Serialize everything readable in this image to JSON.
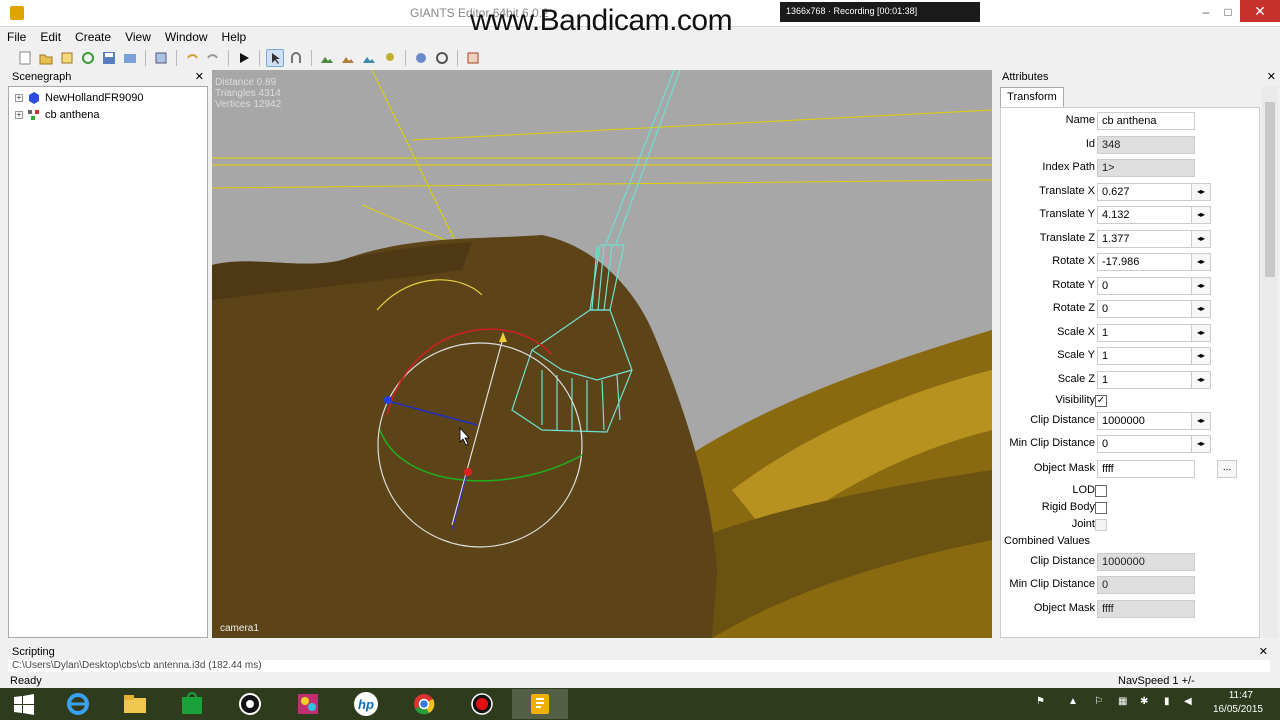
{
  "window": {
    "title": "GIANTS Editor 64bit 6.0.2",
    "watermark": "www.Bandicam.com",
    "recording": "1366x768 · Recording [00:01:38]",
    "minimize": "–",
    "maximize": "□",
    "close": "✕"
  },
  "menu": [
    "File",
    "Edit",
    "Create",
    "View",
    "Window",
    "Help"
  ],
  "toolbar": {
    "icons": [
      "new-icon",
      "open-icon",
      "edit-icon",
      "refresh-icon",
      "save-icon",
      "export-icon",
      "import-icon",
      "undo-icon",
      "redo-icon",
      "play-icon",
      "select-icon",
      "magnet-icon",
      "terrain-icon",
      "paint-icon",
      "foliage-icon",
      "plant-icon",
      "settings-icon",
      "sync-icon",
      "script-icon"
    ]
  },
  "scenegraph": {
    "title": "Scenegraph",
    "close": "✕",
    "items": [
      {
        "label": "NewHollandFR9090",
        "expander": "+"
      },
      {
        "label": "cb anthena",
        "expander": "+"
      }
    ]
  },
  "viewport": {
    "stats": [
      "Distance 0.89",
      "Triangles 4314",
      "Vertices 12942"
    ],
    "camera": "camera1"
  },
  "attributes": {
    "title": "Attributes",
    "close": "✕",
    "tab": "Transform",
    "fields": [
      {
        "label": "Name",
        "value": "cb anthena",
        "kind": "text"
      },
      {
        "label": "Id",
        "value": "348",
        "kind": "readonly"
      },
      {
        "label": "Index Path",
        "value": "1>",
        "kind": "readonly"
      },
      {
        "label": "Translate X",
        "value": "0.627",
        "kind": "spin"
      },
      {
        "label": "Translate Y",
        "value": "4.132",
        "kind": "spin"
      },
      {
        "label": "Translate Z",
        "value": "1.377",
        "kind": "spin"
      },
      {
        "label": "Rotate X",
        "value": "-17.986",
        "kind": "spin"
      },
      {
        "label": "Rotate Y",
        "value": "0",
        "kind": "spin"
      },
      {
        "label": "Rotate Z",
        "value": "0",
        "kind": "spin"
      },
      {
        "label": "Scale X",
        "value": "1",
        "kind": "spin"
      },
      {
        "label": "Scale Y",
        "value": "1",
        "kind": "spin"
      },
      {
        "label": "Scale Z",
        "value": "1",
        "kind": "spin"
      }
    ],
    "visibility": {
      "label": "Visibility",
      "checked": "✓"
    },
    "clip_distance": {
      "label": "Clip Distance",
      "value": "1000000"
    },
    "min_clip_distance": {
      "label": "Min Clip Distance",
      "value": "0"
    },
    "object_mask": {
      "label": "Object Mask",
      "value": "ffff",
      "button": "..."
    },
    "lod": {
      "label": "LOD"
    },
    "rigid_body": {
      "label": "Rigid Body"
    },
    "joint": {
      "label": "Joint"
    },
    "combined": {
      "title": "Combined Values",
      "clip_distance": {
        "label": "Clip Distance",
        "value": "1000000"
      },
      "min_clip_distance": {
        "label": "Min Clip Distance",
        "value": "0"
      },
      "object_mask": {
        "label": "Object Mask",
        "value": "ffff"
      }
    }
  },
  "scripting": {
    "title": "Scripting",
    "close": "✕",
    "log": "C:\\Users\\Dylan\\Desktop\\cbs\\cb antenna.i3d (182.44 ms)"
  },
  "status": {
    "left": "Ready",
    "right": "NavSpeed 1 +/-"
  },
  "taskbar": {
    "apps": [
      "start-icon",
      "ie-icon",
      "explorer-icon",
      "store-icon",
      "media-icon",
      "paint-icon",
      "hp-icon",
      "chrome-icon",
      "record-icon",
      "giants-icon"
    ],
    "hp": "hp",
    "time": "11:47",
    "date": "16/05/2015"
  },
  "colors": {
    "taskbar": "#2e3b1c",
    "accent": "#c7312c",
    "wire": "#6fe0d0"
  }
}
